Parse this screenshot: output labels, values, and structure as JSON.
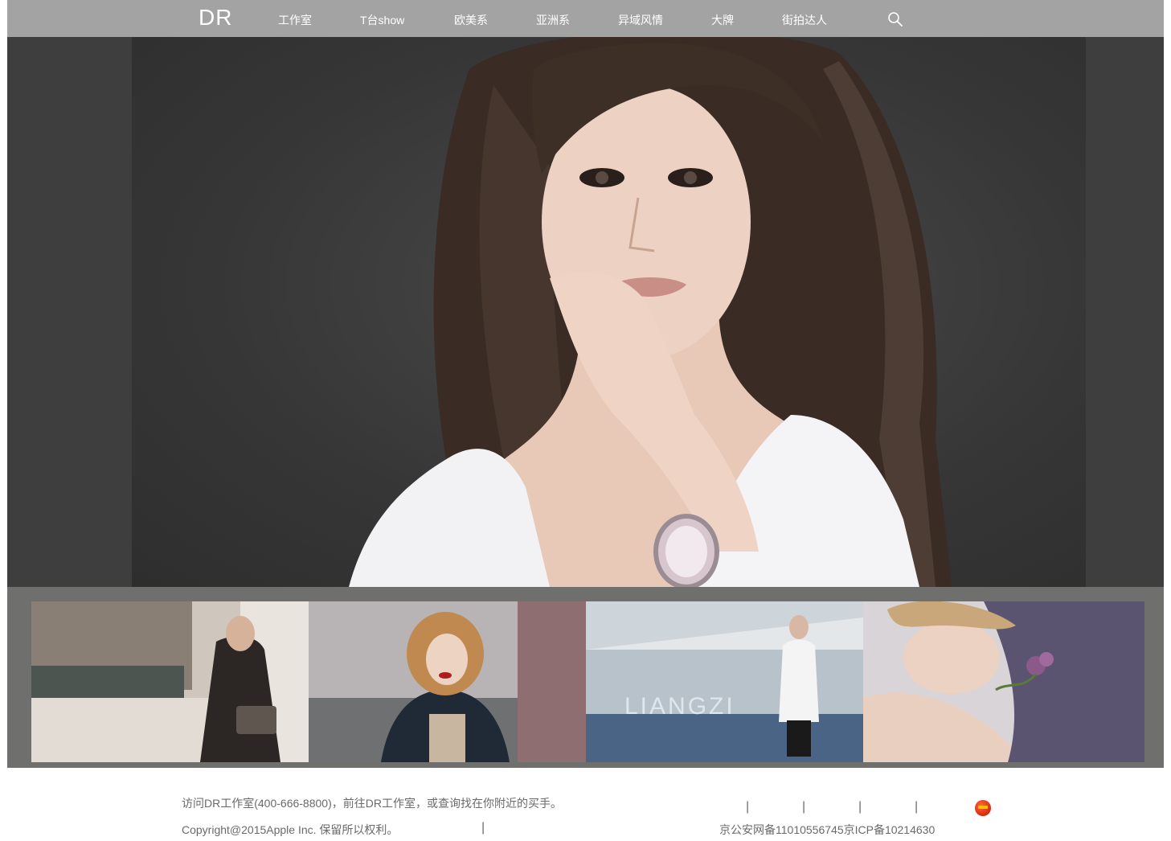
{
  "nav": {
    "logo": "DR",
    "items": [
      {
        "label": "工作室"
      },
      {
        "label": "T台show"
      },
      {
        "label": "欧美系"
      },
      {
        "label": "亚洲系"
      },
      {
        "label": "异域风情"
      },
      {
        "label": "大牌"
      },
      {
        "label": "街拍达人"
      }
    ],
    "search_icon": "search-icon"
  },
  "hero": {
    "image": "portrait-woman-white-shirt-watch"
  },
  "thumbnails": [
    {
      "image": "street-style-woman-sunglasses"
    },
    {
      "image": "curly-hair-woman-red-lips"
    },
    {
      "image": "woman-white-sweater",
      "overlay_text": "LIANGZI"
    },
    {
      "image": "woman-lying-with-flower"
    }
  ],
  "footer": {
    "visit_text": "访问DR工作室(400-666-8800)，前往DR工作室，或查询找在你附近的买手。",
    "copyright": "Copyright@2015Apple Inc. 保留所以权利。",
    "record": "京公安网备11010556745京ICP备10214630",
    "separator": "|",
    "flag_icon": "china-flag-icon"
  }
}
